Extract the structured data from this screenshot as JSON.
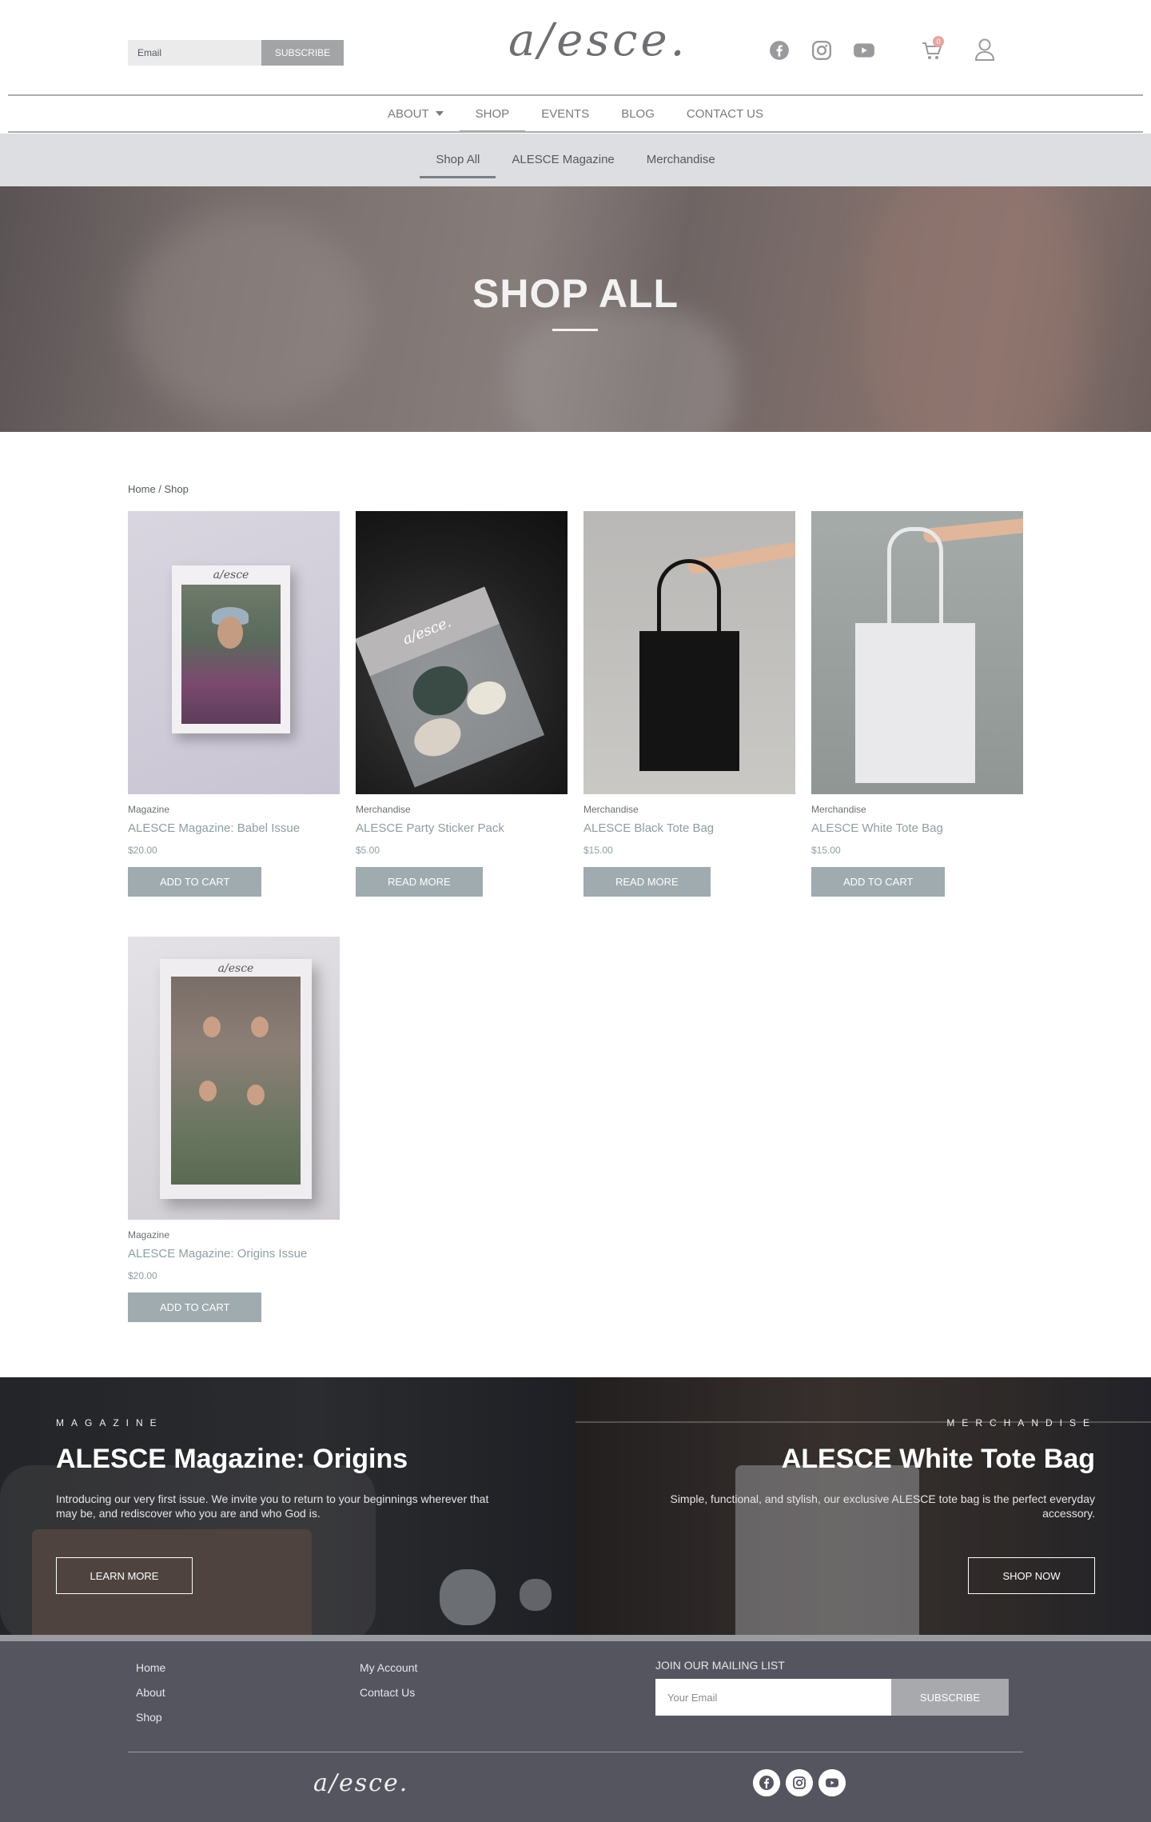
{
  "header": {
    "email_placeholder": "Email",
    "subscribe_label": "SUBSCRIBE",
    "logo_text": "a/esce.",
    "cart_count": "0",
    "social_icons": [
      "facebook-icon",
      "instagram-icon",
      "youtube-icon"
    ]
  },
  "nav": {
    "items": [
      {
        "label": "ABOUT"
      },
      {
        "label": "SHOP"
      },
      {
        "label": "EVENTS"
      },
      {
        "label": "BLOG"
      },
      {
        "label": "CONTACT US"
      }
    ],
    "active": "SHOP"
  },
  "subnav": {
    "items": [
      {
        "label": "Shop All"
      },
      {
        "label": "ALESCE Magazine"
      },
      {
        "label": "Merchandise"
      }
    ],
    "active": "Shop All"
  },
  "hero": {
    "title": "SHOP ALL"
  },
  "breadcrumb": "Home / Shop",
  "products": [
    {
      "category": "Magazine",
      "title": "ALESCE Magazine: Babel Issue",
      "price": "$20.00",
      "button": "ADD TO CART"
    },
    {
      "category": "Merchandise",
      "title": "ALESCE Party Sticker Pack",
      "price": "$5.00",
      "button": "READ MORE"
    },
    {
      "category": "Merchandise",
      "title": "ALESCE Black Tote Bag",
      "price": "$15.00",
      "button": "READ MORE"
    },
    {
      "category": "Merchandise",
      "title": "ALESCE White Tote Bag",
      "price": "$15.00",
      "button": "ADD TO CART"
    },
    {
      "category": "Magazine",
      "title": "ALESCE Magazine: Origins Issue",
      "price": "$20.00",
      "button": "ADD TO CART"
    }
  ],
  "promos": {
    "left": {
      "eyebrow": "MAGAZINE",
      "title": "ALESCE Magazine: Origins",
      "text": "Introducing our very first issue. We invite you to return to your beginnings wherever that may be, and rediscover who you are and who God is.",
      "button": "LEARN MORE"
    },
    "right": {
      "eyebrow": "MERCHANDISE",
      "title": "ALESCE White Tote Bag",
      "text": "Simple, functional, and stylish, our exclusive ALESCE tote bag is the perfect everyday accessory.",
      "button": "SHOP NOW"
    }
  },
  "footer": {
    "links_col1": [
      "Home",
      "About",
      "Shop"
    ],
    "links_col2": [
      "My Account",
      "Contact Us"
    ],
    "mailing_heading": "JOIN OUR MAILING LIST",
    "email_placeholder": "Your Email",
    "subscribe_label": "SUBSCRIBE",
    "logo_text": "a/esce."
  },
  "colors": {
    "accent": "#9fabae",
    "footer_bg": "#54555f",
    "subnav_bg": "#dcdee1",
    "product_title": "#8e9ea3"
  }
}
